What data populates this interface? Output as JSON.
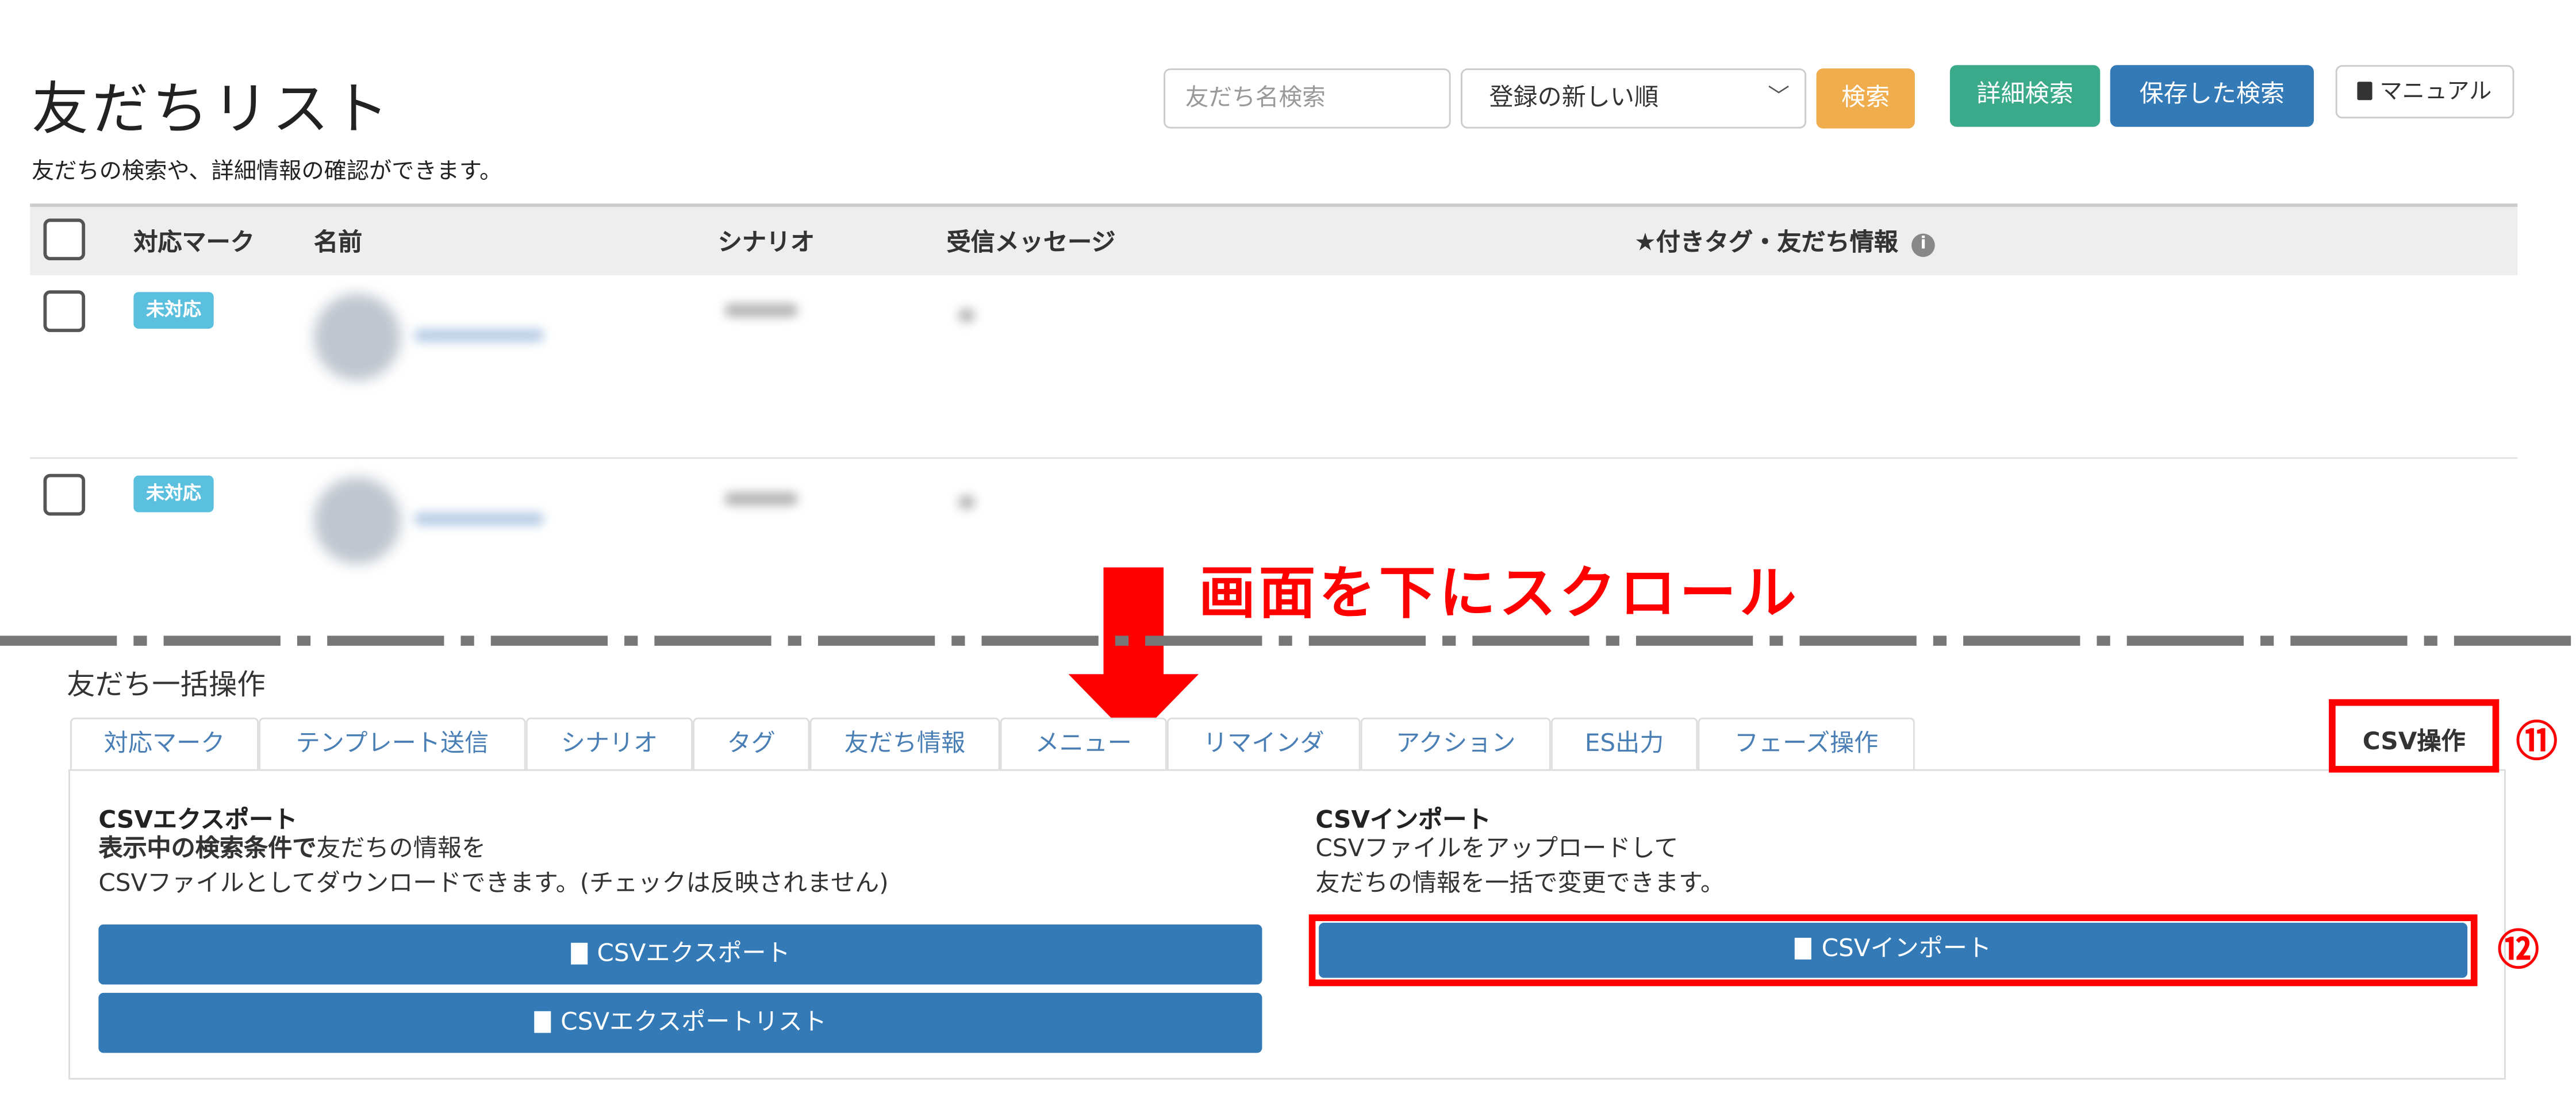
{
  "header": {
    "title": "友だちリスト",
    "subtitle": "友だちの検索や、詳細情報の確認ができます。"
  },
  "search": {
    "placeholder": "友だち名検索",
    "sort_selected": "登録の新しい順",
    "search_label": "検索",
    "detail_search_label": "詳細検索",
    "saved_search_label": "保存した検索",
    "manual_label": "マニュアル"
  },
  "table": {
    "columns": [
      "対応マーク",
      "名前",
      "シナリオ",
      "受信メッセージ",
      "★付きタグ・友だち情報"
    ],
    "rows": [
      {
        "status": "未対応"
      },
      {
        "status": "未対応"
      }
    ]
  },
  "annotation": {
    "scroll_text": "画面を下にスクロール",
    "marker_11": "⑪",
    "marker_12": "⑫"
  },
  "bulk": {
    "section_title": "友だち一括操作",
    "tabs": [
      "対応マーク",
      "テンプレート送信",
      "シナリオ",
      "タグ",
      "友だち情報",
      "メニュー",
      "リマインダ",
      "アクション",
      "ES出力",
      "フェーズ操作"
    ],
    "active_tab": "CSV操作",
    "export": {
      "heading": "CSVエクスポート",
      "desc_bold": "表示中の検索条件で",
      "desc_rest": "友だちの情報を",
      "desc_line2": "CSVファイルとしてダウンロードできます。(チェックは反映されません)",
      "button": "CSVエクスポート",
      "list_button": "CSVエクスポートリスト"
    },
    "import": {
      "heading": "CSVインポート",
      "desc_line1": "CSVファイルをアップロードして",
      "desc_line2": "友だちの情報を一括で変更できます。",
      "button": "CSVインポート"
    }
  },
  "colors": {
    "primary": "#337ab7",
    "warning": "#f0ad4e",
    "teal": "#3aaa8a",
    "badge": "#5bc0de",
    "annotation_red": "#ff0000"
  }
}
